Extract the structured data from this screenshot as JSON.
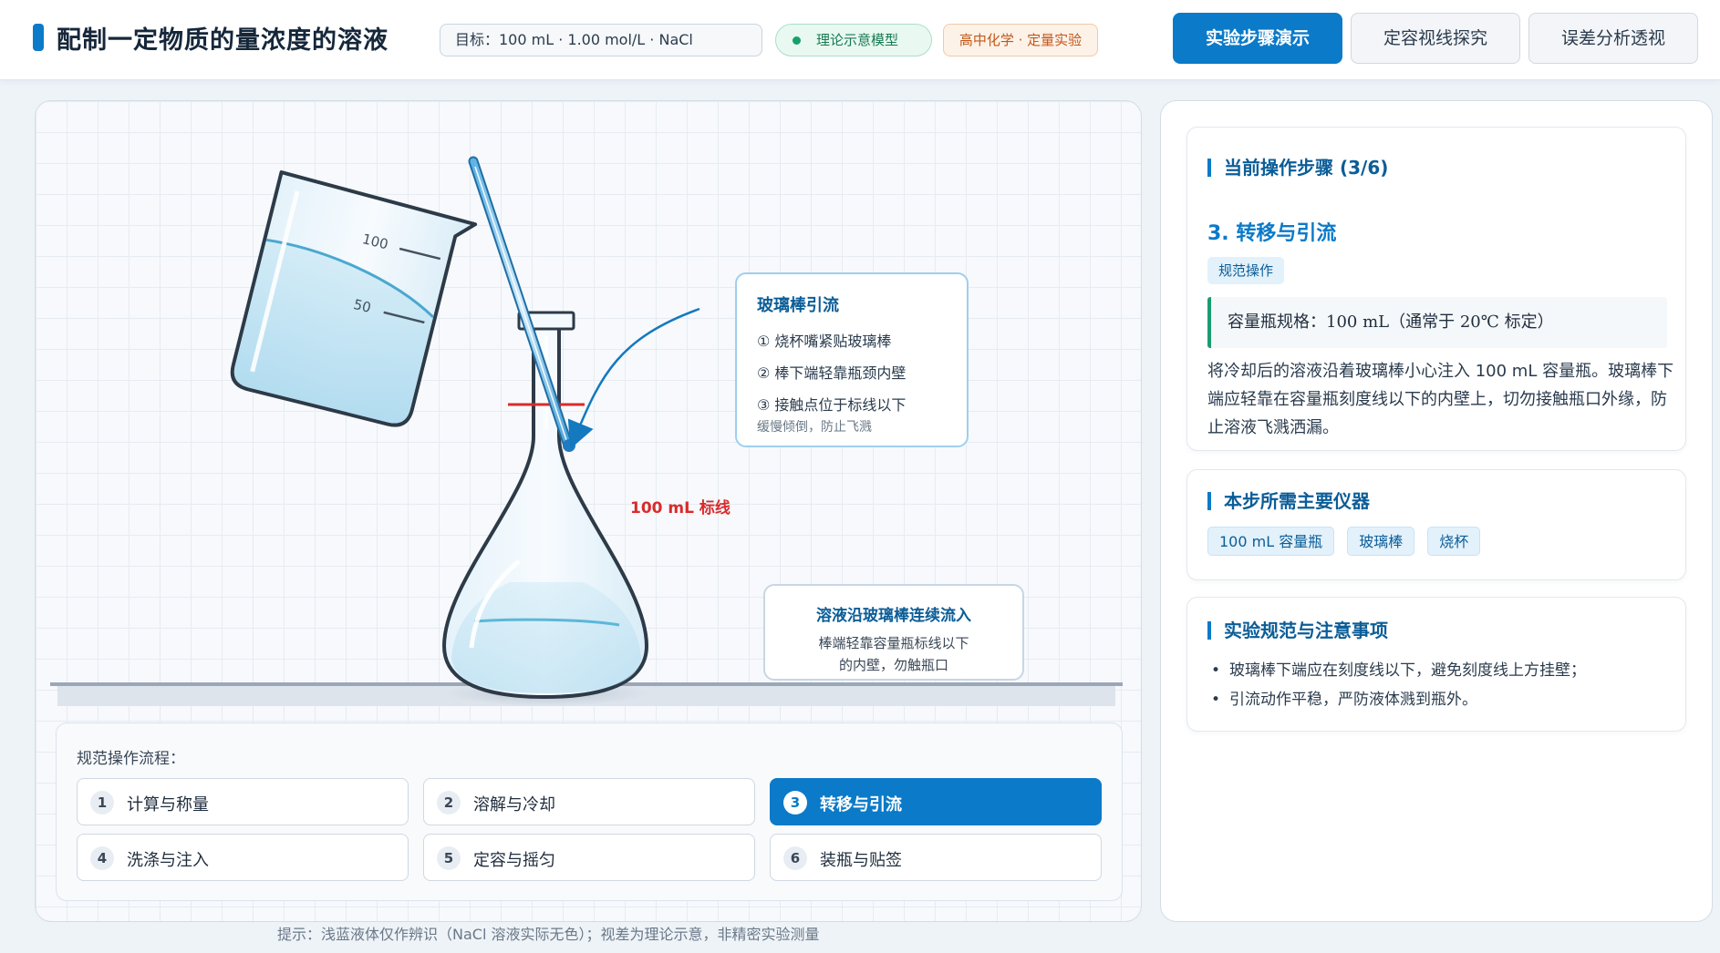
{
  "header": {
    "title": "配制一定物质的量浓度的溶液",
    "target": "目标：100 mL · 1.00 mol/L · NaCl",
    "model_badge": "理论示意模型",
    "course_badge": "高中化学 · 定量实验",
    "nav": [
      "实验步骤演示",
      "定容视线探究",
      "误差分析透视"
    ]
  },
  "stage": {
    "beaker_marks": [
      "100",
      "50"
    ],
    "mark_label": "100 mL 标线",
    "callout_rod": {
      "title": "玻璃棒引流",
      "lines": [
        "① 烧杯嘴紧贴玻璃棒",
        "② 棒下端轻靠瓶颈内壁",
        "③ 接触点位于标线以下"
      ],
      "sub": "缓慢倾倒，防止飞溅"
    },
    "callout_flow": {
      "title": "溶液沿玻璃棒连续流入",
      "body_1": "棒端轻靠容量瓶标线以下",
      "body_2": "的内壁，勿触瓶口"
    },
    "steps_title": "规范操作流程：",
    "steps": [
      {
        "num": "1",
        "label": "计算与称量"
      },
      {
        "num": "2",
        "label": "溶解与冷却"
      },
      {
        "num": "3",
        "label": "转移与引流"
      },
      {
        "num": "4",
        "label": "洗涤与注入"
      },
      {
        "num": "5",
        "label": "定容与摇匀"
      },
      {
        "num": "6",
        "label": "装瓶与贴签"
      }
    ],
    "active_step": 3,
    "hint": "提示：浅蓝液体仅作辨识（NaCl 溶液实际无色）；视差为理论示意，非精密实验测量"
  },
  "side": {
    "current": {
      "head": "当前操作步骤 (3/6)",
      "name": "3. 转移与引流",
      "tag": "规范操作",
      "spec": "容量瓶规格：100 mL（通常于 20℃ 标定）",
      "desc": "将冷却后的溶液沿着玻璃棒小心注入 100 mL 容量瓶。玻璃棒下端应轻靠在容量瓶刻度线以下的内壁上，切勿接触瓶口外缘，防止溶液飞溅洒漏。"
    },
    "instruments": {
      "head": "本步所需主要仪器",
      "items": [
        "100 mL 容量瓶",
        "玻璃棒",
        "烧杯"
      ]
    },
    "notes": {
      "head": "实验规范与注意事项",
      "items": [
        "玻璃棒下端应在刻度线以下，避免刻度线上方挂壁；",
        "引流动作平稳，严防液体溅到瓶外。"
      ]
    }
  },
  "colors": {
    "accent": "#0b7ac8",
    "liquid": "#bfe3f3",
    "mark_line": "#d92b2b",
    "success": "#17a06a",
    "warning": "#c2571a"
  }
}
